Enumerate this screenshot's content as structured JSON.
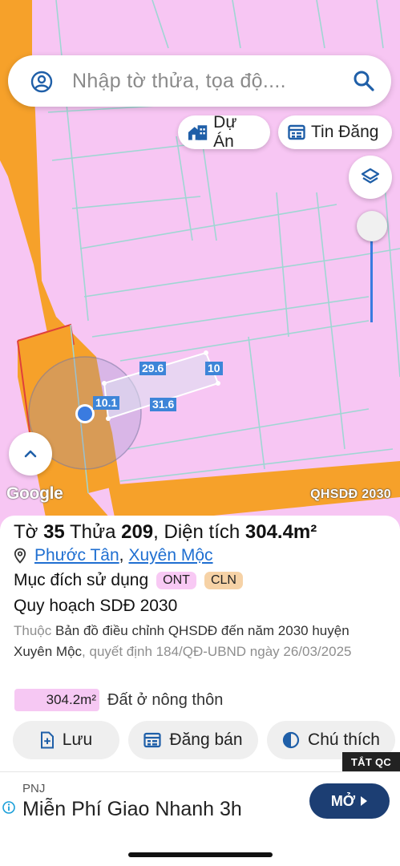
{
  "search": {
    "placeholder": "Nhập tờ thửa, tọa độ...."
  },
  "chips": {
    "du_an": "Dự Án",
    "tin_dang": "Tin Đăng"
  },
  "map": {
    "dimension_labels": [
      "29.6",
      "10",
      "10.1",
      "31.6"
    ],
    "attribution": "Google",
    "layer_label": "QHSDĐ 2030",
    "zone_color": "#f7c6f3",
    "road_color": "#f6a12a"
  },
  "parcel": {
    "to_label": "Tờ",
    "to_number": "35",
    "thua_label": "Thửa",
    "thua_number": "209",
    "area_label": ", Diện tích",
    "area_value": "304.4m²",
    "ward": "Phước Tân",
    "district": "Xuyên Mộc",
    "purpose_label": "Mục đích sử dụng",
    "purpose_tags": [
      "ONT",
      "CLN"
    ],
    "plan_title": "Quy hoạch SDĐ 2030",
    "desc_prefix": "Thuộc",
    "desc_main": "Bản đồ điều chỉnh QHSDĐ đến năm 2030 huyện Xuyên Mộc",
    "desc_suffix": ", quyết định 184/QĐ-UBND ngày 26/03/2025",
    "zone_area": "304.2m²",
    "zone_name": "Đất ở nông thôn"
  },
  "actions": {
    "save": "Lưu",
    "post": "Đăng bán",
    "legend": "Chú thích"
  },
  "ad": {
    "close_label": "TẮT QC",
    "brand": "PNJ",
    "headline": "Miễn Phí Giao Nhanh 3h",
    "cta": "MỞ"
  }
}
